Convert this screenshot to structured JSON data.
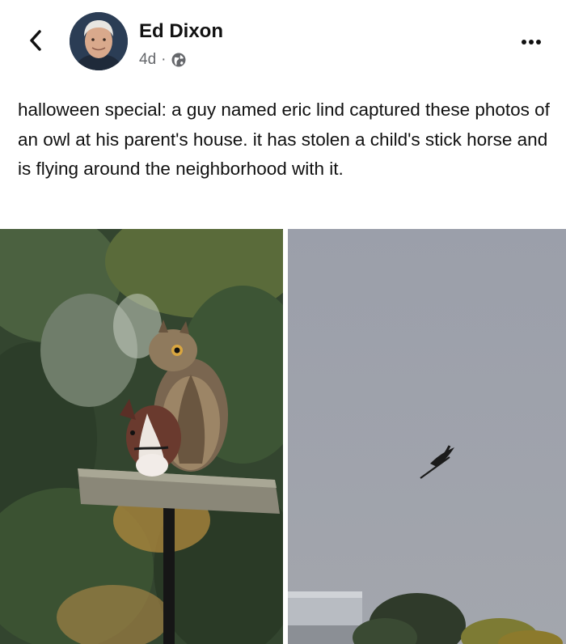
{
  "post": {
    "author_name": "Ed Dixon",
    "timestamp": "4d",
    "separator": "·",
    "privacy_icon": "globe-icon",
    "text": "halloween special: a guy named eric lind captured these photos of an owl at his parent's house. it has stolen a child's stick horse and is flying around the neighborhood with it."
  },
  "header": {
    "back_icon": "chevron-left-icon",
    "more_icon": "more-dots-icon"
  },
  "photos": [
    {
      "subject": "owl perched with stick horse"
    },
    {
      "subject": "owl flying with stick horse"
    }
  ],
  "colors": {
    "text": "#111111",
    "meta": "#65676b",
    "sky": "#9a9ea8"
  }
}
